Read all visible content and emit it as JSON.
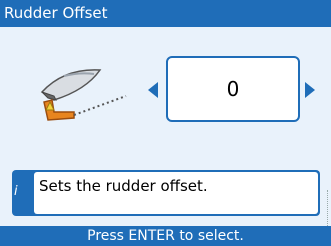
{
  "window": {
    "title": "Rudder Offset"
  },
  "control": {
    "value": "0"
  },
  "help": {
    "icon": "i",
    "text": "Sets the rudder offset."
  },
  "footer": {
    "prompt": "Press ENTER to select."
  },
  "colors": {
    "accent": "#1f6db8",
    "background": "#e9f2fb"
  },
  "icons": {
    "left": "left-arrow-icon",
    "right": "right-arrow-icon",
    "illustration": "rudder-boat-illustration"
  }
}
